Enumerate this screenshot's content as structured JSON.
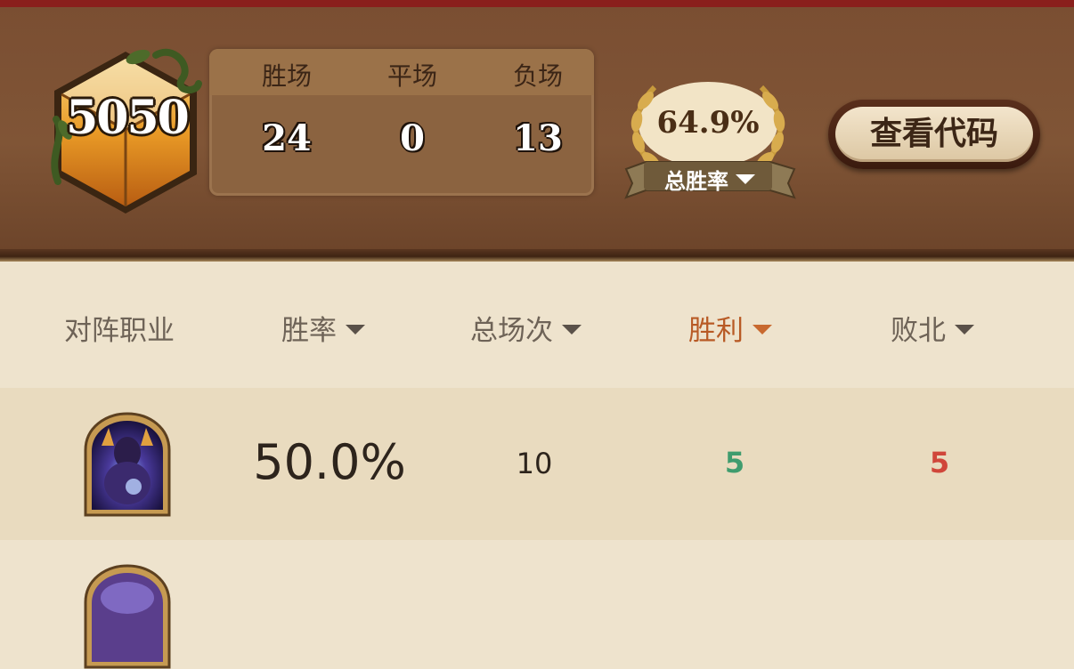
{
  "header": {
    "rank": "5050",
    "stats": [
      {
        "label": "胜场",
        "value": "24"
      },
      {
        "label": "平场",
        "value": "0"
      },
      {
        "label": "负场",
        "value": "13"
      }
    ],
    "win_rate": {
      "value": "64.9%",
      "label": "总胜率"
    },
    "view_code_button": "查看代码"
  },
  "table": {
    "columns": [
      {
        "label": "对阵职业",
        "sortable": false
      },
      {
        "label": "胜率",
        "sortable": true
      },
      {
        "label": "总场次",
        "sortable": true
      },
      {
        "label": "胜利",
        "sortable": true,
        "active": true
      },
      {
        "label": "败北",
        "sortable": true
      }
    ],
    "rows": [
      {
        "class_icon": "warlock-portrait-icon",
        "win_rate": "50.0%",
        "games": "10",
        "wins": "5",
        "losses": "5"
      }
    ]
  },
  "colors": {
    "header_brown": "#805536",
    "active_sort": "#b85a25",
    "wins_green": "#3f9c6e",
    "losses_red": "#d0463a"
  }
}
